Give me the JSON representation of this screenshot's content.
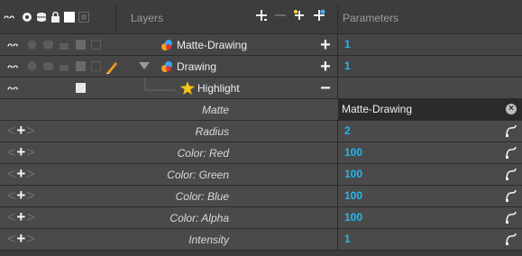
{
  "header": {
    "layers_label": "Layers",
    "parameters_label": "Parameters",
    "column_icons": [
      "animate-onoff-icon",
      "eye-icon",
      "database-icon",
      "lock-icon",
      "white-swatch-icon",
      "thumbnail-icon"
    ],
    "tools": [
      "add-layer-icon",
      "remove-layer-icon",
      "add-peg-icon",
      "add-effect-icon"
    ]
  },
  "layers": [
    {
      "name": "Matte-Drawing",
      "value": "1",
      "action": "+"
    },
    {
      "name": "Drawing",
      "value": "1",
      "action": "+"
    },
    {
      "name": "Highlight",
      "value": "",
      "action": "−"
    }
  ],
  "parameters": [
    {
      "label": "Matte",
      "value": "Matte-Drawing",
      "kind": "matte"
    },
    {
      "label": "Radius",
      "value": "2"
    },
    {
      "label": "Color: Red",
      "value": "100"
    },
    {
      "label": "Color: Green",
      "value": "100"
    },
    {
      "label": "Color: Blue",
      "value": "100"
    },
    {
      "label": "Color: Alpha",
      "value": "100"
    },
    {
      "label": "Intensity",
      "value": "1"
    }
  ],
  "colors": {
    "value_blue": "#22b8f0",
    "star_yellow": "#f5c518",
    "pencil_orange": "#f09a1a"
  }
}
